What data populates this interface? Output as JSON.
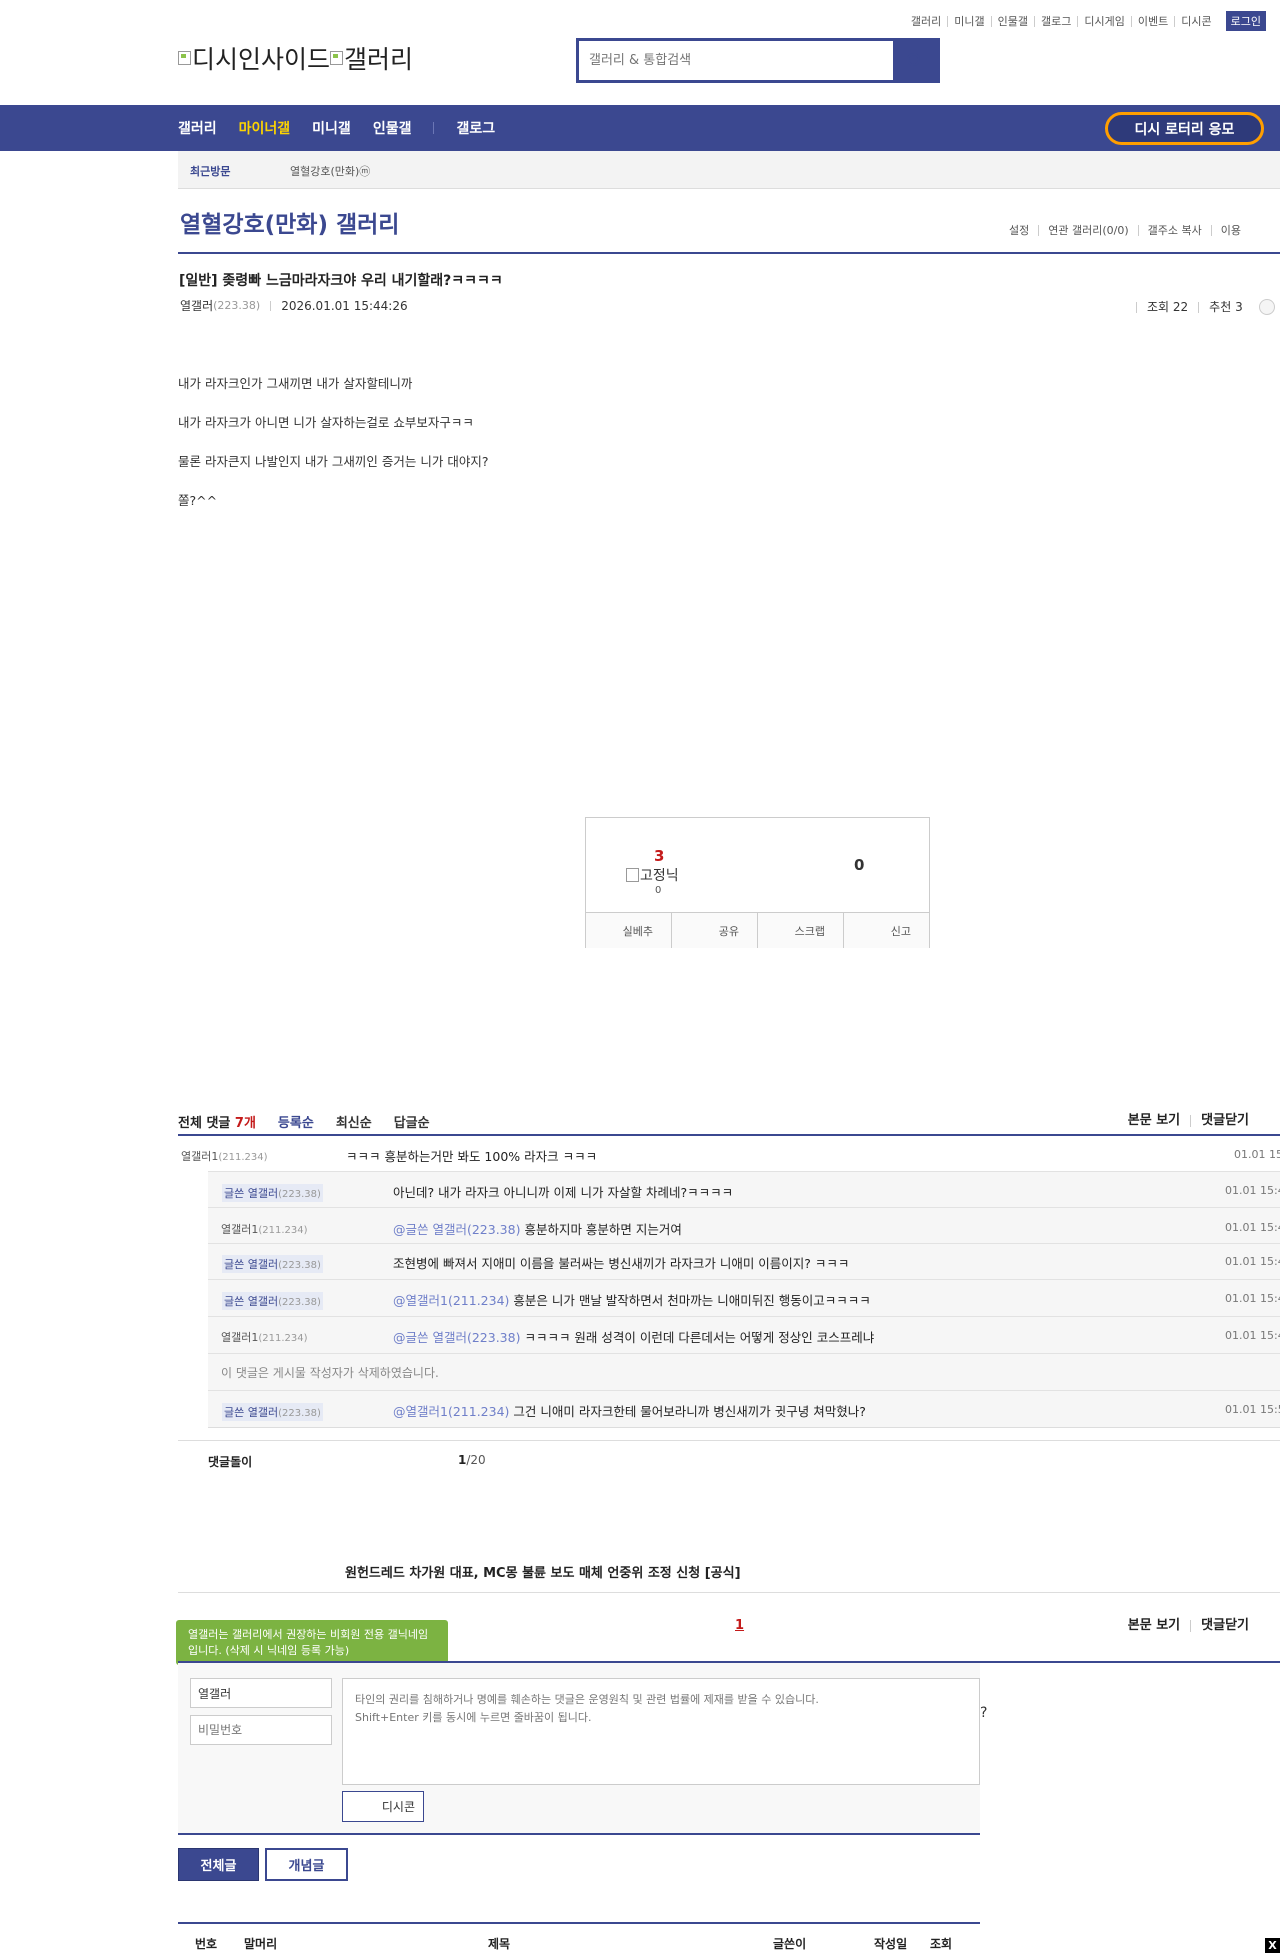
{
  "util_menu": [
    "갤러리",
    "미니갤",
    "인물갤",
    "갤로그",
    "디시게임",
    "이벤트",
    "디시콘"
  ],
  "login_label": "로그인",
  "logo_text_1": "디시인사이드",
  "logo_text_2": "갤러리",
  "search_placeholder": "갤러리 & 통합검색",
  "gnb": {
    "items": [
      "갤러리",
      "마이너갤",
      "미니갤",
      "인물갤"
    ],
    "gallog": "갤로그",
    "lottery": "디시 로터리 응모"
  },
  "recent": {
    "label": "최근방문",
    "gallery": "열혈강호(만화)ⓜ"
  },
  "gallery": {
    "title": "열혈강호(만화) 갤러리",
    "options": [
      "설정",
      "연관 갤러리(0/0)",
      "갤주소 복사",
      "이용"
    ]
  },
  "post": {
    "title": "[일반] 좆령빠 느금마라자크야 우리 내기할래?ㅋㅋㅋㅋ",
    "author": "열갤러",
    "author_ip": "(223.38)",
    "date": "2026.01.01 15:44:26",
    "views": "조회 22",
    "recommend": "추천 3",
    "body": [
      "내가 라자크인가 그새끼면 내가 살자할테니까",
      "내가 라자크가 아니면 니가 살자하는걸로 쇼부보자구ㅋㅋ",
      "물론 라자큰지 나발인지 내가 그새끼인 증거는 니가 대야지?",
      "쫄?^^"
    ]
  },
  "vote": {
    "up": "3",
    "fixed_label": "고정닉",
    "fixed_count": "0",
    "down": "0",
    "buttons": [
      "실베추",
      "공유",
      "스크랩",
      "신고"
    ]
  },
  "comments": {
    "total_label": "전체 댓글",
    "count": "7개",
    "sorts": [
      "등록순",
      "최신순",
      "답글순"
    ],
    "right": [
      "본문 보기",
      "댓글닫기"
    ],
    "list": [
      {
        "nick": "열갤러1",
        "ip": "(211.234)",
        "at": "",
        "text": "ㅋㅋㅋ 흥분하는거만 봐도 100% 라자크 ㅋㅋㅋ",
        "date": "01.01 15"
      },
      {
        "nick": "글쓴 열갤러",
        "ip": "(223.38)",
        "at": "",
        "text": "아닌데? 내가 라자크 아니니까 이제 니가 자살할 차례네?ㅋㅋㅋㅋ",
        "date": "01.01 15:4"
      },
      {
        "nick": "열갤러1",
        "ip": "(211.234)",
        "at": "@글쓴 열갤러(223.38)",
        "text": " 흥분하지마 흥분하면 지는거여",
        "date": "01.01 15:4"
      },
      {
        "nick": "글쓴 열갤러",
        "ip": "(223.38)",
        "at": "",
        "text": "조현병에 빠져서 지애미 이름을 불러싸는 병신새끼가 라자크가 니애미 이름이지? ㅋㅋㅋ",
        "date": "01.01 15:4"
      },
      {
        "nick": "글쓴 열갤러",
        "ip": "(223.38)",
        "at": "@열갤러1(211.234)",
        "text": " 흥분은 니가 맨날 발작하면서 천마까는 니애미뒤진 행동이고ㅋㅋㅋㅋ",
        "date": "01.01 15:4"
      },
      {
        "nick": "열갤러1",
        "ip": "(211.234)",
        "at": "@글쓴 열갤러(223.38)",
        "text": " ㅋㅋㅋㅋ 원래 성격이 이런데 다른데서는 어떻게 정상인 코스프레냐",
        "date": "01.01 15:4"
      },
      {
        "nick": "",
        "ip": "",
        "at": "",
        "text": "이 댓글은 게시물 작성자가 삭제하였습니다.",
        "date": ""
      },
      {
        "nick": "글쓴 열갤러",
        "ip": "(223.38)",
        "at": "@열갤러1(211.234)",
        "text": " 그건 니애미 라자크한테 물어보라니까 병신새끼가 귓구녕 쳐막혔나?",
        "date": "01.01 15:5"
      }
    ],
    "footer_label": "댓글돌이",
    "page_current": "1",
    "page_total": "/20"
  },
  "ad_text": "원헌드레드 차가원 대표, MC몽 불륜 보도 매체 언중위 조정 신청 [공식]",
  "write": {
    "tip": "열갤러는 갤러리에서 권장하는 비회원 전용 갤닉네임입니다. (삭제 시 닉네임 등록 가능)",
    "page": "1",
    "right": [
      "본문 보기",
      "댓글닫기"
    ],
    "name_value": "열갤러",
    "password_placeholder": "비밀번호",
    "textarea_placeholder": "타인의 권리를 침해하거나 명예를 훼손하는 댓글은 운영원칙 및 관련 법률에 제재를 받을 수 있습니다.\nShift+Enter 키를 동시에 누르면 줄바꿈이 됩니다.",
    "help": "?",
    "dccon": "디시콘"
  },
  "list_tabs": {
    "all": "전체글",
    "concept": "개념글"
  },
  "list_headers": [
    "번호",
    "말머리",
    "제목",
    "글쓴이",
    "작성일",
    "조회"
  ],
  "close_label": "X",
  "colors": {
    "brand": "#3b4890",
    "accent": "#fdd400",
    "lottery_border": "#ff9e00",
    "tip": "#7cb342",
    "red": "#c41a1a"
  }
}
